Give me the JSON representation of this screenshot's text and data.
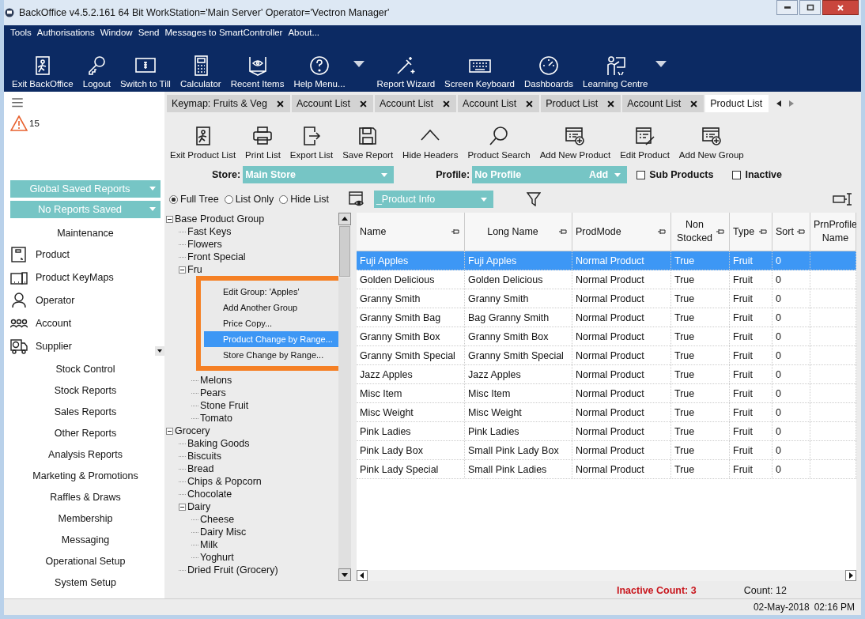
{
  "window": {
    "title": "BackOffice v4.5.2.161 64 Bit WorkStation='Main Server'  Operator='Vectron Manager'"
  },
  "menu": [
    "Tools",
    "Authorisations",
    "Window",
    "Send",
    "Messages to SmartController",
    "About..."
  ],
  "toolbar": [
    {
      "label": "Exit BackOffice",
      "kind": "exit",
      "has_menu": false
    },
    {
      "label": "Logout",
      "kind": "key",
      "has_menu": false
    },
    {
      "label": "Switch to Till",
      "kind": "till",
      "has_menu": false
    },
    {
      "label": "Calculator",
      "kind": "calculator",
      "has_menu": false
    },
    {
      "label": "Recent Items",
      "kind": "eye",
      "has_menu": false
    },
    {
      "label": "Help Menu...",
      "kind": "help",
      "has_menu": true
    },
    {
      "label": "Report Wizard",
      "kind": "wand",
      "has_menu": false
    },
    {
      "label": "Screen Keyboard",
      "kind": "keyboard",
      "has_menu": false
    },
    {
      "label": "Dashboards",
      "kind": "gauge",
      "has_menu": false
    },
    {
      "label": "Learning Centre",
      "kind": "teacher",
      "has_menu": true
    }
  ],
  "sidebar": {
    "alert_count": "15",
    "report_selectors": [
      "Global Saved Reports",
      "No Reports Saved"
    ],
    "section_title": "Maintenance",
    "items": [
      {
        "label": "Product",
        "kind": "box"
      },
      {
        "label": "Product KeyMaps",
        "kind": "devices"
      },
      {
        "label": "Operator",
        "kind": "person"
      },
      {
        "label": "Account",
        "kind": "people"
      },
      {
        "label": "Supplier",
        "kind": "truck"
      }
    ],
    "sections": [
      "Stock Control",
      "Stock Reports",
      "Sales Reports",
      "Other Reports",
      "Analysis Reports",
      "Marketing & Promotions",
      "Raffles & Draws",
      "Membership",
      "Messaging",
      "Operational Setup",
      "System Setup"
    ]
  },
  "tabs": [
    {
      "label": "Keymap: Fruits & Veg",
      "selected": false,
      "closable": true
    },
    {
      "label": "Account List",
      "selected": false,
      "closable": true
    },
    {
      "label": "Account List",
      "selected": false,
      "closable": true
    },
    {
      "label": "Account List",
      "selected": false,
      "closable": true
    },
    {
      "label": "Product List",
      "selected": false,
      "closable": true
    },
    {
      "label": "Account List",
      "selected": false,
      "closable": true
    },
    {
      "label": "Product List",
      "selected": true,
      "closable": false
    }
  ],
  "product_toolbar": [
    {
      "label": "Exit Product List",
      "kind": "exit"
    },
    {
      "label": "Print List",
      "kind": "print"
    },
    {
      "label": "Export List",
      "kind": "export"
    },
    {
      "label": "Save Report",
      "kind": "save"
    },
    {
      "label": "Hide Headers",
      "kind": "caret"
    },
    {
      "label": "Product Search",
      "kind": "search"
    },
    {
      "label": "Add New Product",
      "kind": "add"
    },
    {
      "label": "Edit Product",
      "kind": "edit"
    },
    {
      "label": "Add New Group",
      "kind": "add"
    }
  ],
  "filters": {
    "store_label": "Store:",
    "store": "Main Store",
    "profile_label": "Profile:",
    "profile": "No Profile",
    "profile_action": "Add",
    "options": [
      {
        "label": "Sub Products",
        "checked": false
      },
      {
        "label": "Inactive",
        "checked": false
      }
    ]
  },
  "view": {
    "modes": [
      {
        "label": "Full Tree",
        "selected": true
      },
      {
        "label": "List Only",
        "selected": false
      },
      {
        "label": "Hide List",
        "selected": false
      }
    ],
    "info_view": "_Product Info"
  },
  "tree": [
    {
      "label": "Base Product Group",
      "expanded": true,
      "children": [
        {
          "label": "Fast Keys"
        },
        {
          "label": "Flowers"
        },
        {
          "label": "Front Special"
        },
        {
          "label": "Fru",
          "expanded": true,
          "menu_open": true,
          "children": [
            {
              "label": "Melons"
            },
            {
              "label": "Pears"
            },
            {
              "label": "Stone Fruit"
            },
            {
              "label": "Tomato"
            }
          ]
        }
      ]
    },
    {
      "label": "Grocery",
      "expanded": true,
      "children": [
        {
          "label": "Baking Goods"
        },
        {
          "label": "Biscuits"
        },
        {
          "label": "Bread"
        },
        {
          "label": "Chips & Popcorn"
        },
        {
          "label": "Chocolate"
        },
        {
          "label": "Dairy",
          "expanded": true,
          "children": [
            {
              "label": "Cheese"
            },
            {
              "label": "Dairy Misc"
            },
            {
              "label": "Milk"
            },
            {
              "label": "Yoghurt"
            }
          ]
        },
        {
          "label": "Dried Fruit (Grocery)"
        }
      ]
    }
  ],
  "context_menu": [
    {
      "label": "Edit Group: 'Apples'",
      "selected": false
    },
    {
      "label": "Add Another Group",
      "selected": false
    },
    {
      "label": "Price Copy...",
      "selected": false
    },
    {
      "label": "Product Change by Range...",
      "selected": true
    },
    {
      "label": "Store Change by Range...",
      "selected": false
    }
  ],
  "table": {
    "columns": [
      "Name",
      "Long Name",
      "ProdMode",
      "Non Stocked",
      "Type",
      "Sort",
      "PrnProfile Name"
    ],
    "rows": [
      {
        "selected": true,
        "cells": [
          "Fuji Apples",
          "Fuji Apples",
          "Normal Product",
          "True",
          "Fruit",
          "0"
        ]
      },
      {
        "selected": false,
        "cells": [
          "Golden Delicious",
          "Golden Delicious",
          "Normal Product",
          "True",
          "Fruit",
          "0"
        ]
      },
      {
        "selected": false,
        "cells": [
          "Granny Smith",
          "Granny Smith",
          "Normal Product",
          "True",
          "Fruit",
          "0"
        ]
      },
      {
        "selected": false,
        "cells": [
          "Granny Smith Bag",
          "Bag Granny Smith",
          "Normal Product",
          "True",
          "Fruit",
          "0"
        ]
      },
      {
        "selected": false,
        "cells": [
          "Granny Smith Box",
          "Granny Smith Box",
          "Normal Product",
          "True",
          "Fruit",
          "0"
        ]
      },
      {
        "selected": false,
        "cells": [
          "Granny Smith Special",
          "Granny Smith Special",
          "Normal Product",
          "True",
          "Fruit",
          "0"
        ]
      },
      {
        "selected": false,
        "cells": [
          "Jazz Apples",
          "Jazz Apples",
          "Normal Product",
          "True",
          "Fruit",
          "0"
        ]
      },
      {
        "selected": false,
        "cells": [
          "Misc Item",
          "Misc Item",
          "Normal Product",
          "True",
          "Fruit",
          "0"
        ]
      },
      {
        "selected": false,
        "cells": [
          "Misc Weight",
          "Misc Weight",
          "Normal Product",
          "True",
          "Fruit",
          "0"
        ]
      },
      {
        "selected": false,
        "cells": [
          "Pink Ladies",
          "Pink Ladies",
          "Normal Product",
          "True",
          "Fruit",
          "0"
        ]
      },
      {
        "selected": false,
        "cells": [
          "Pink Lady Box",
          "Small Pink Lady Box",
          "Normal Product",
          "True",
          "Fruit",
          "0"
        ]
      },
      {
        "selected": false,
        "cells": [
          "Pink Lady Special",
          "Small Pink Ladies",
          "Normal Product",
          "True",
          "Fruit",
          "0"
        ]
      }
    ]
  },
  "footer": {
    "inactive_count": "Inactive Count: 3",
    "count": "Count: 12"
  },
  "status_bar": {
    "date": "02-May-2018",
    "time": "02:16 PM"
  }
}
